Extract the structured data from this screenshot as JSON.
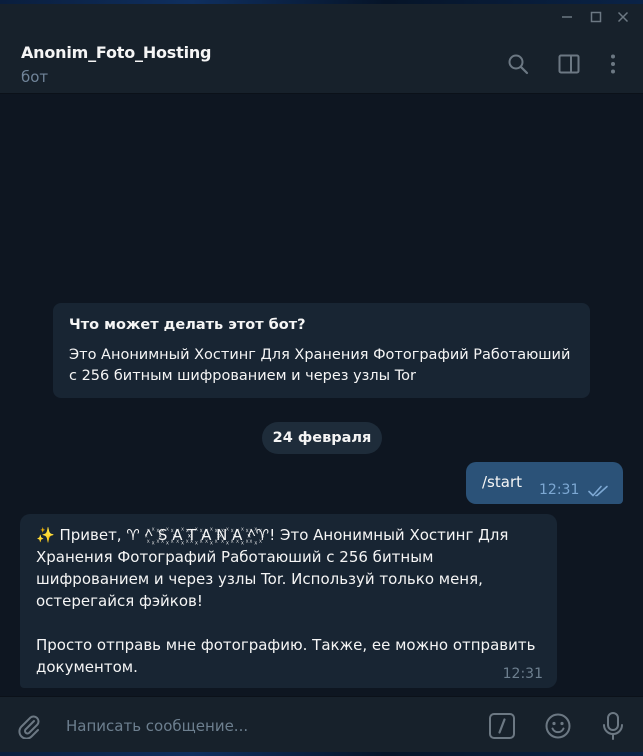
{
  "header": {
    "title": "Anonim_Foto_Hosting",
    "subtitle": "бот"
  },
  "bot_info": {
    "title": "Что может делать этот бот?",
    "text": "Это Анонимный Хостинг Для Хранения Фотографий Работаюший с 256 битным шифрованием и через узлы Tor"
  },
  "date_separator": "24 февраля",
  "outgoing_message": {
    "text": "/start",
    "time": "12:31",
    "status": "read"
  },
  "incoming_message": {
    "text": "✨ Привет, ♈ ^꙰ S꙰ A꙰ T꙰ A꙰ N꙰ A꙰ ^꙰♈! Это Анонимный Хостинг Для Хранения Фотографий Работаюший с 256 битным шифрованием и через узлы Tor. Используй только меня, остерегайся фэйков!\n\nПросто отправь мне фотографию. Также, ее можно отправить документом.",
    "time": "12:31"
  },
  "composer": {
    "placeholder": "Написать сообщение..."
  },
  "icons": {
    "window": [
      "minimize-icon",
      "maximize-icon",
      "close-icon"
    ],
    "header": [
      "search-icon",
      "sidebar-toggle-icon",
      "more-vertical-icon"
    ],
    "composer": [
      "paperclip-icon",
      "bot-command-icon",
      "emoji-icon",
      "microphone-icon"
    ]
  },
  "colors": {
    "background": "#0e1621",
    "header": "#17212b",
    "incoming_bubble": "#182533",
    "outgoing_bubble": "#2b5278",
    "accent": "#7da8d3"
  }
}
